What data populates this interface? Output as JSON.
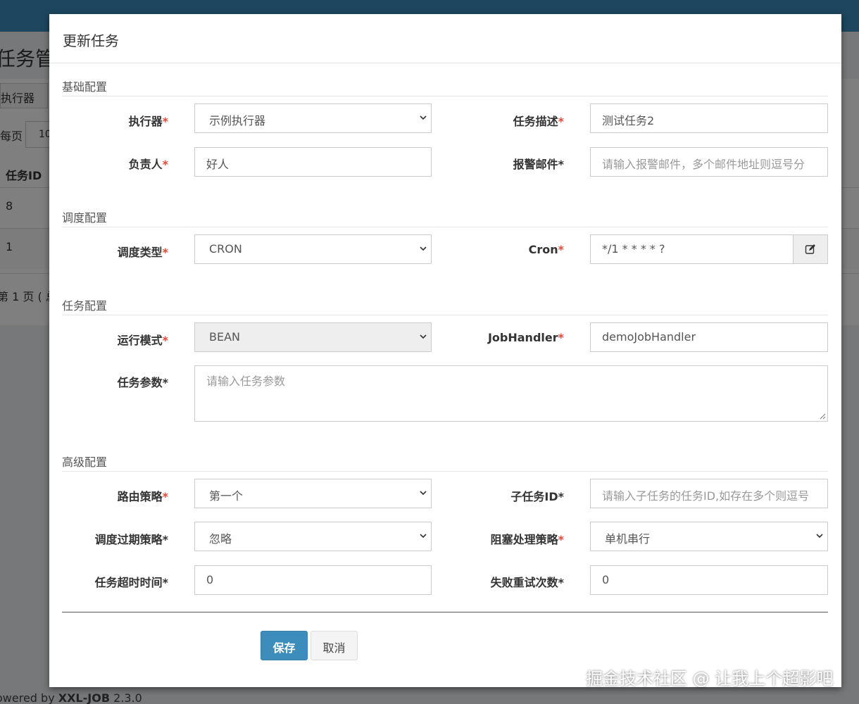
{
  "background": {
    "page_title": "任务管",
    "executor_label": "执行器",
    "per_page_label": "每页",
    "per_page_value": "10",
    "table_header_id": "任务ID",
    "rows": [
      "8",
      "1"
    ],
    "page_info": "第 1 页 ( 总",
    "footer_prefix": "owered by ",
    "footer_brand": "XXL-JOB",
    "footer_version": " 2.3.0"
  },
  "modal": {
    "title": "更新任务",
    "sections": {
      "basic": "基础配置",
      "schedule": "调度配置",
      "task": "任务配置",
      "advanced": "高级配置"
    },
    "fields": {
      "executor": {
        "label": "执行器",
        "value": "示例执行器"
      },
      "job_desc": {
        "label": "任务描述",
        "value": "测试任务2"
      },
      "author": {
        "label": "负责人",
        "value": "好人"
      },
      "alarm_email": {
        "label": "报警邮件",
        "placeholder": "请输入报警邮件，多个邮件地址则逗号分"
      },
      "schedule_type": {
        "label": "调度类型",
        "value": "CRON"
      },
      "cron": {
        "label": "Cron",
        "value": "*/1 * * * * ?"
      },
      "glue_type": {
        "label": "运行模式",
        "value": "BEAN"
      },
      "job_handler": {
        "label": "JobHandler",
        "value": "demoJobHandler"
      },
      "job_param": {
        "label": "任务参数",
        "placeholder": "请输入任务参数"
      },
      "route_strategy": {
        "label": "路由策略",
        "value": "第一个"
      },
      "child_job_id": {
        "label": "子任务ID",
        "placeholder": "请输入子任务的任务ID,如存在多个则逗号"
      },
      "misfire_strategy": {
        "label": "调度过期策略",
        "value": "忽略"
      },
      "block_strategy": {
        "label": "阻塞处理策略",
        "value": "单机串行"
      },
      "timeout": {
        "label": "任务超时时间",
        "value": "0"
      },
      "fail_retry": {
        "label": "失败重试次数",
        "value": "0"
      }
    },
    "buttons": {
      "save": "保存",
      "cancel": "取消"
    }
  },
  "watermark": "掘金技术社区 @ 让我上个超影吧",
  "colors": {
    "header": "#3c8dbc",
    "primary": "#3c8dbc",
    "required": "#dd4b39"
  }
}
